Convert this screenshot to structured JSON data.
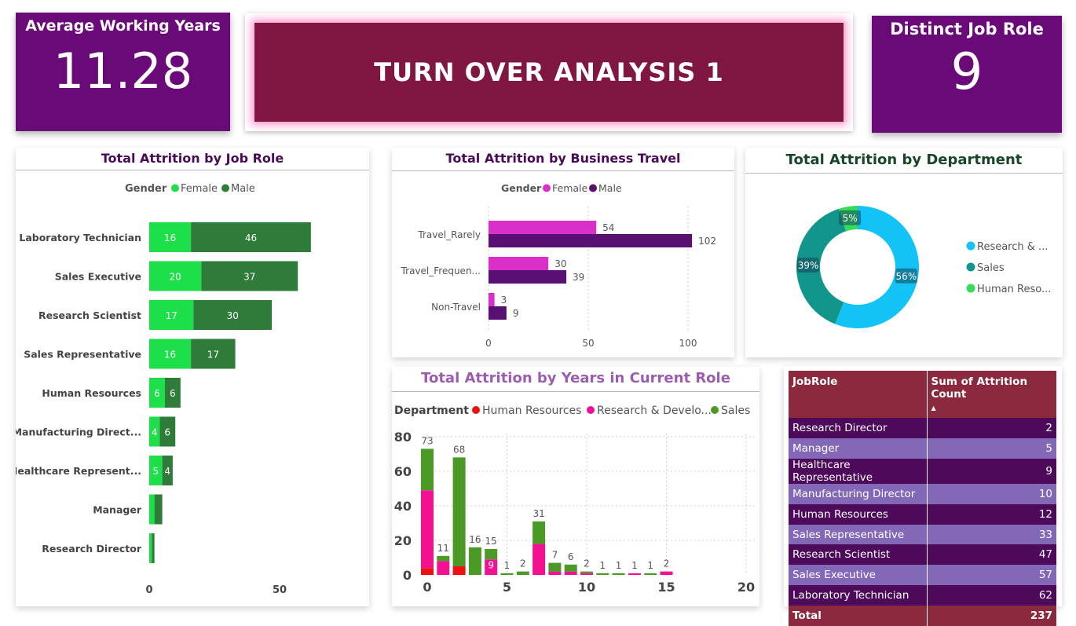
{
  "kpi_avg": {
    "label": "Average Working Years",
    "value": "11.28"
  },
  "kpi_roles": {
    "label": "Distinct Job Role",
    "value": "9"
  },
  "banner": {
    "title": "TURN OVER ANALYSIS 1"
  },
  "colors": {
    "purple": "#6a0a79",
    "banner": "#801743",
    "female_green": "#1ddf4a",
    "male_green": "#2e7b3a",
    "female_pink": "#d930c8",
    "male_purple": "#5a0f73",
    "dept_blue": "#13c3f5",
    "dept_teal": "#12958a",
    "dept_green": "#35dd5a",
    "hr_red": "#ee1111",
    "rd_pink": "#f21190",
    "sales_green": "#4b9a25"
  },
  "job_role_chart": {
    "title": "Total Attrition by Job Role",
    "legend_title": "Gender",
    "legend": [
      "Female",
      "Male"
    ],
    "x_ticks": [
      "0",
      "50"
    ]
  },
  "travel_chart": {
    "title": "Total Attrition by Business Travel",
    "legend_title": "Gender",
    "legend": [
      "Female",
      "Male"
    ],
    "x_ticks": [
      "0",
      "50",
      "100"
    ]
  },
  "dept_chart": {
    "title": "Total Attrition by Department",
    "legend": [
      "Research & ...",
      "Sales",
      "Human Reso..."
    ]
  },
  "years_chart": {
    "title": "Total Attrition by Years in Current Role",
    "legend_title": "Department",
    "legend": [
      "Human Resources",
      "Research & Develo...",
      "Sales"
    ]
  },
  "table": {
    "headers": [
      "JobRole",
      "Sum of Attrition Count"
    ],
    "rows": [
      [
        "Research Director",
        "2"
      ],
      [
        "Manager",
        "5"
      ],
      [
        "Healthcare Representative",
        "9"
      ],
      [
        "Manufacturing Director",
        "10"
      ],
      [
        "Human Resources",
        "12"
      ],
      [
        "Sales Representative",
        "33"
      ],
      [
        "Research Scientist",
        "47"
      ],
      [
        "Sales Executive",
        "57"
      ],
      [
        "Laboratory Technician",
        "62"
      ]
    ],
    "total": [
      "Total",
      "237"
    ]
  },
  "chart_data": [
    {
      "type": "bar",
      "title": "Total Attrition by Job Role",
      "orientation": "horizontal",
      "stacked": true,
      "categories": [
        "Laboratory Technician",
        "Sales Executive",
        "Research Scientist",
        "Sales Representative",
        "Human Resources",
        "Manufacturing Direct...",
        "Healthcare Represent...",
        "Manager",
        "Research Director"
      ],
      "series": [
        {
          "name": "Female",
          "values": [
            16,
            20,
            17,
            16,
            6,
            4,
            5,
            2,
            1
          ]
        },
        {
          "name": "Male",
          "values": [
            46,
            37,
            30,
            17,
            6,
            6,
            4,
            3,
            1
          ]
        }
      ],
      "xlim": [
        0,
        62
      ],
      "legend_title": "Gender"
    },
    {
      "type": "bar",
      "title": "Total Attrition by Business Travel",
      "orientation": "horizontal",
      "stacked": false,
      "categories": [
        "Travel_Rarely",
        "Travel_Frequen...",
        "Non-Travel"
      ],
      "series": [
        {
          "name": "Female",
          "values": [
            54,
            30,
            3
          ]
        },
        {
          "name": "Male",
          "values": [
            102,
            39,
            9
          ]
        }
      ],
      "xlim": [
        0,
        100
      ],
      "legend_title": "Gender"
    },
    {
      "type": "pie",
      "title": "Total Attrition by Department",
      "donut": true,
      "categories": [
        "Research & ...",
        "Sales",
        "Human Reso..."
      ],
      "values": [
        56,
        39,
        5
      ],
      "labels": [
        "56%",
        "39%",
        "5%"
      ],
      "legend_placement": "right"
    },
    {
      "type": "bar",
      "title": "Total Attrition by Years in Current Role",
      "stacked": true,
      "x": [
        0,
        1,
        2,
        3,
        4,
        5,
        6,
        7,
        8,
        9,
        10,
        11,
        12,
        13,
        14,
        15
      ],
      "series": [
        {
          "name": "Human Resources",
          "values": [
            4,
            0,
            5,
            0,
            0,
            0,
            0,
            0,
            0,
            0,
            0,
            0,
            0,
            0,
            0,
            0
          ]
        },
        {
          "name": "Research & Develo...",
          "values": [
            45,
            8,
            0,
            0,
            9,
            0,
            0,
            18,
            2,
            2,
            1,
            0,
            0,
            1,
            0,
            2
          ]
        },
        {
          "name": "Sales",
          "values": [
            24,
            3,
            63,
            16,
            6,
            1,
            2,
            13,
            5,
            4,
            1,
            1,
            1,
            0,
            1,
            0
          ]
        }
      ],
      "totals": [
        73,
        11,
        68,
        16,
        15,
        1,
        2,
        31,
        7,
        6,
        2,
        1,
        1,
        1,
        1,
        2
      ],
      "inner_label": {
        "index": 4,
        "text": "9"
      },
      "x_ticks": [
        "0",
        "5",
        "10",
        "15",
        "20"
      ],
      "y_ticks": [
        "0",
        "20",
        "40",
        "60",
        "80"
      ],
      "xlim": [
        0,
        20
      ],
      "ylim": [
        0,
        80
      ],
      "grid": true,
      "legend_title": "Department"
    }
  ]
}
